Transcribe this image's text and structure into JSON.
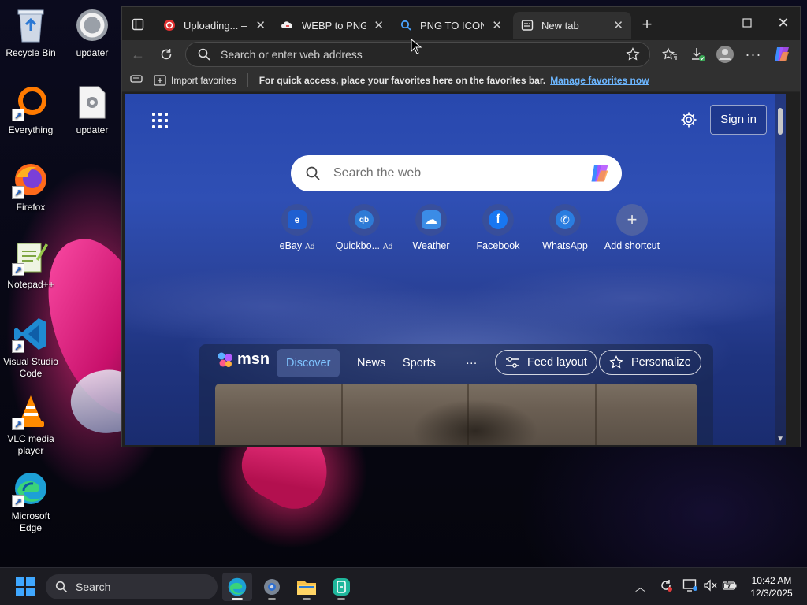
{
  "desktop": {
    "icons": [
      {
        "label": "Recycle Bin",
        "icon": "recycle-bin-icon"
      },
      {
        "label": "updater",
        "icon": "updater-icon"
      },
      {
        "label": "Everything",
        "icon": "everything-icon"
      },
      {
        "label": "updater",
        "icon": "updater-settings-icon"
      },
      {
        "label": "Firefox",
        "icon": "firefox-icon"
      },
      {
        "label": "Notepad++",
        "icon": "notepadpp-icon"
      },
      {
        "label": "Visual Studio Code",
        "icon": "vscode-icon"
      },
      {
        "label": "VLC media player",
        "icon": "vlc-icon"
      },
      {
        "label": "Microsoft Edge",
        "icon": "edge-icon"
      }
    ]
  },
  "browser": {
    "tabs": [
      {
        "title": "Uploading... — C",
        "icon": "red-logo-icon",
        "active": false
      },
      {
        "title": "WEBP to PNG | C",
        "icon": "cloud-icon",
        "active": false
      },
      {
        "title": "PNG TO ICON - S",
        "icon": "search-icon",
        "active": false
      },
      {
        "title": "New tab",
        "icon": "new-tab-page-icon",
        "active": true
      }
    ],
    "address": {
      "placeholder": "Search or enter web address",
      "value": ""
    },
    "favorites_bar": {
      "import_label": "Import favorites",
      "message": "For quick access, place your favorites here on the favorites bar.",
      "link": "Manage favorites now"
    },
    "colors": {
      "accent_link": "#6cb6ff",
      "chrome": "#303030",
      "tabstrip": "#202020"
    }
  },
  "newtab": {
    "signin_label": "Sign in",
    "search_placeholder": "Search the web",
    "shortcuts": [
      {
        "label": "eBay",
        "ad": "Ad",
        "color": "#1f5fd1",
        "glyph": "e"
      },
      {
        "label": "Quickbo...",
        "ad": "Ad",
        "color": "#2e7bd6",
        "glyph": "qb"
      },
      {
        "label": "Weather",
        "ad": "",
        "color": "#3b8ce6",
        "glyph": "☁"
      },
      {
        "label": "Facebook",
        "ad": "",
        "color": "#1877f2",
        "glyph": "f"
      },
      {
        "label": "WhatsApp",
        "ad": "",
        "color": "#2a7de0",
        "glyph": "✆"
      },
      {
        "label": "Add shortcut",
        "ad": "",
        "color": "",
        "glyph": "+"
      }
    ],
    "feed": {
      "logo": "msn",
      "tabs": [
        "Discover",
        "News",
        "Sports"
      ],
      "more": "···",
      "feed_layout_label": "Feed layout",
      "personalize_label": "Personalize"
    }
  },
  "taskbar": {
    "search_label": "Search",
    "time": "10:42 AM",
    "date": "12/3/2025"
  }
}
